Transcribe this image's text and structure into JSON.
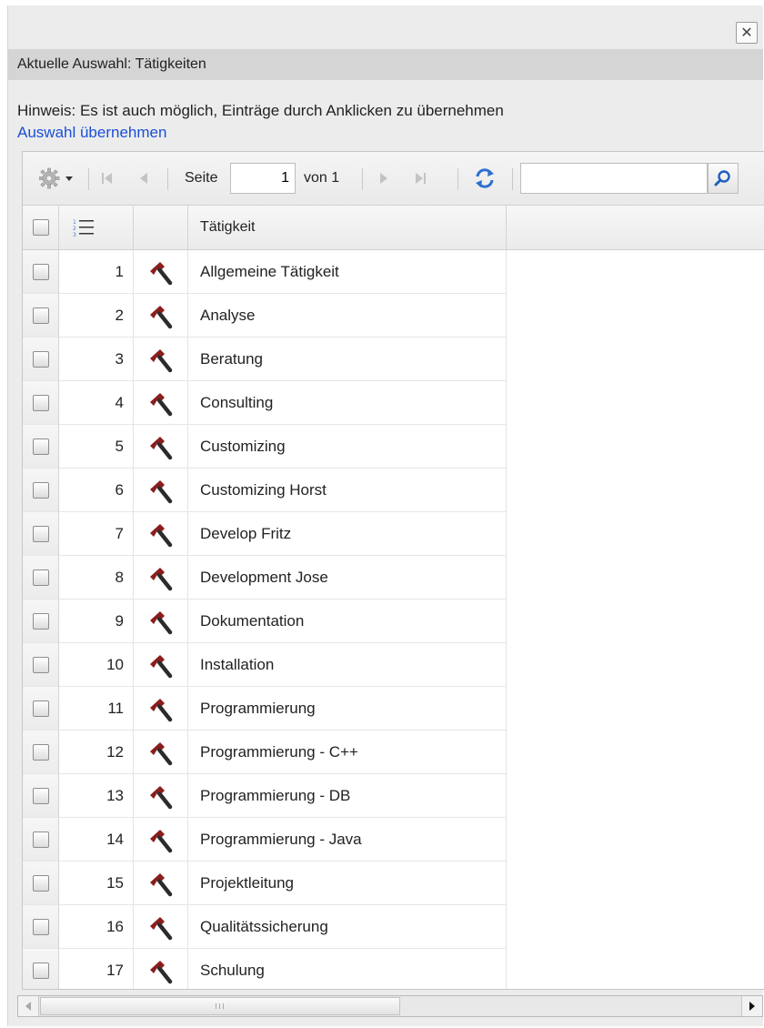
{
  "dialog": {
    "close_symbol": "✕",
    "selection_text": "Aktuelle Auswahl: Tätigkeiten",
    "hint_text": "Hinweis: Es ist auch möglich, Einträge durch Anklicken zu übernehmen",
    "accept_link": "Auswahl übernehmen"
  },
  "toolbar": {
    "settings_icon": "gear-icon",
    "page_label": "Seite",
    "page_value": "1",
    "of_label": "von 1",
    "search_value": ""
  },
  "grid": {
    "column_header": "Tätigkeit",
    "row_icon": "hammer-icon",
    "rows": [
      {
        "num": "1",
        "name": "Allgemeine Tätigkeit"
      },
      {
        "num": "2",
        "name": "Analyse"
      },
      {
        "num": "3",
        "name": "Beratung"
      },
      {
        "num": "4",
        "name": "Consulting"
      },
      {
        "num": "5",
        "name": "Customizing"
      },
      {
        "num": "6",
        "name": "Customizing Horst"
      },
      {
        "num": "7",
        "name": "Develop Fritz"
      },
      {
        "num": "8",
        "name": "Development Jose"
      },
      {
        "num": "9",
        "name": "Dokumentation"
      },
      {
        "num": "10",
        "name": "Installation"
      },
      {
        "num": "11",
        "name": "Programmierung"
      },
      {
        "num": "12",
        "name": "Programmierung - C++"
      },
      {
        "num": "13",
        "name": "Programmierung - DB"
      },
      {
        "num": "14",
        "name": "Programmierung - Java"
      },
      {
        "num": "15",
        "name": "Projektleitung"
      },
      {
        "num": "16",
        "name": "Qualitätssicherung"
      },
      {
        "num": "17",
        "name": "Schulung"
      }
    ]
  },
  "colors": {
    "link": "#1a4fd6",
    "hammer_head": "#8b1d1d",
    "hammer_handle": "#2b2b2b",
    "refresh": "#2d6fd0"
  }
}
